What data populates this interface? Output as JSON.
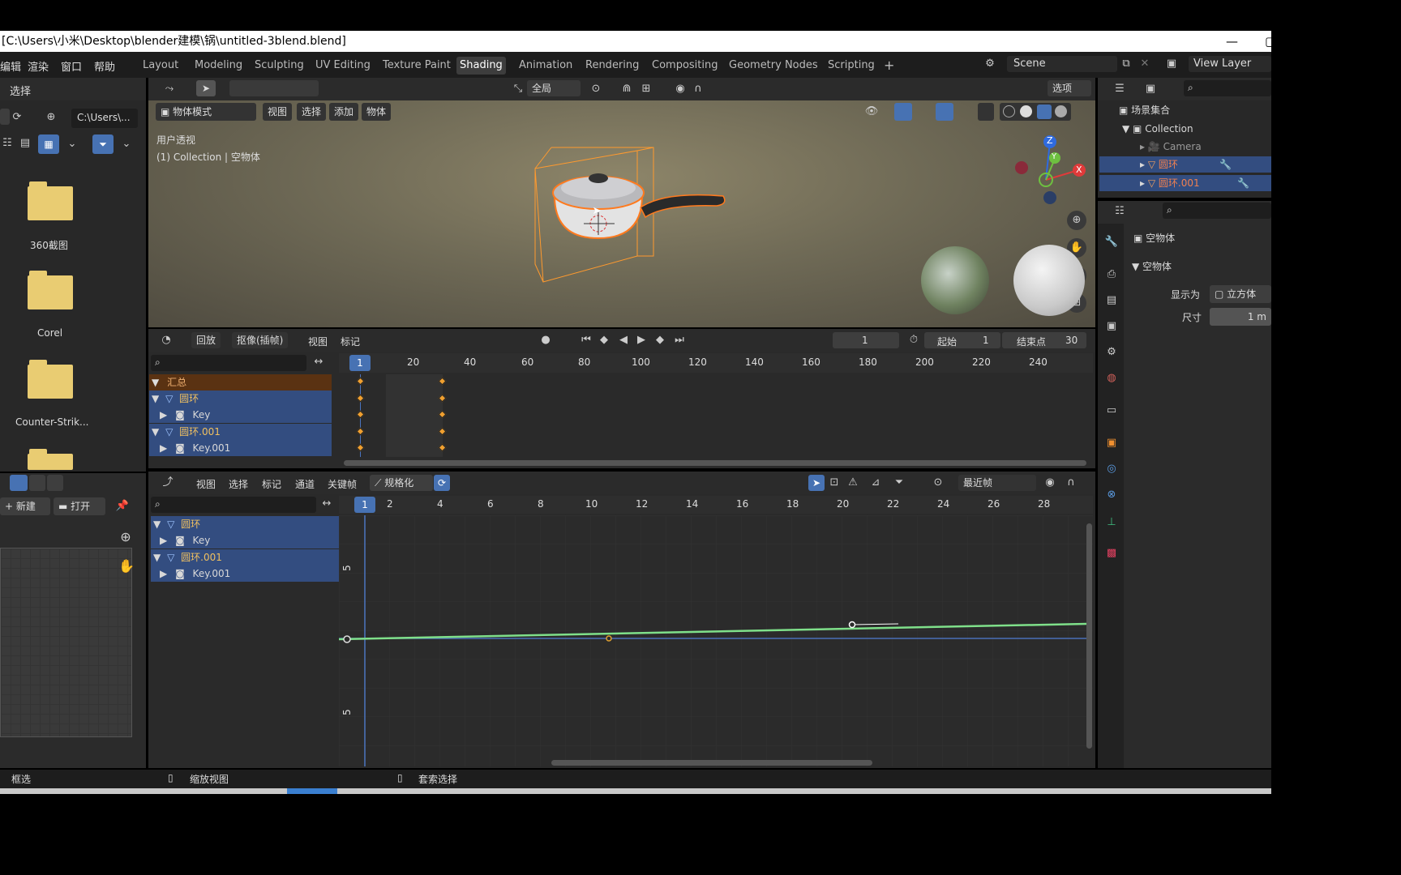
{
  "window": {
    "title": "[C:\\Users\\小米\\Desktop\\blender建模\\锅\\untitled-3blend.blend]"
  },
  "menu": {
    "items": [
      "编辑",
      "渲染",
      "窗口",
      "帮助"
    ]
  },
  "workspaces": {
    "tabs": [
      "Layout",
      "Modeling",
      "Sculpting",
      "UV Editing",
      "Texture Paint",
      "Shading",
      "Animation",
      "Rendering",
      "Compositing",
      "Geometry Nodes",
      "Scripting"
    ],
    "active": "Shading",
    "add": "+"
  },
  "scene": {
    "name": "Scene",
    "view_layer": "View Layer"
  },
  "filebrowser": {
    "header_label": "选择",
    "path": "C:\\Users\\...",
    "folders": [
      "360截图",
      "Corel",
      "Counter-Strik..."
    ]
  },
  "viewport": {
    "mode": "物体模式",
    "menus": [
      "视图",
      "选择",
      "添加",
      "物体"
    ],
    "transform_orientation": "全局",
    "options": "选项",
    "overlay_title": "用户透视",
    "overlay_sub": "(1) Collection | 空物体",
    "gizmo": {
      "z": "Z",
      "y": "Y",
      "x": "X"
    }
  },
  "timeline": {
    "menus": [
      "回放",
      "抠像(插帧)",
      "视图",
      "标记"
    ],
    "current_frame": "1",
    "start_label": "起始",
    "start": "1",
    "end_label": "结束点",
    "end": "30",
    "ruler": [
      "1",
      "20",
      "40",
      "60",
      "80",
      "100",
      "120",
      "140",
      "160",
      "180",
      "200",
      "220",
      "240"
    ],
    "channels": [
      {
        "label": "汇总",
        "kind": "summary"
      },
      {
        "label": "圆环",
        "kind": "object"
      },
      {
        "label": "Key",
        "kind": "key"
      },
      {
        "label": "圆环.001",
        "kind": "object"
      },
      {
        "label": "Key.001",
        "kind": "key"
      }
    ]
  },
  "graph": {
    "menus": [
      "视图",
      "选择",
      "标记",
      "通道",
      "关键帧"
    ],
    "normalize": "规格化",
    "snap": "最近帧",
    "ruler": [
      "1",
      "2",
      "4",
      "6",
      "8",
      "10",
      "12",
      "14",
      "16",
      "18",
      "20",
      "22",
      "24",
      "26",
      "28"
    ],
    "y_ticks": [
      "5",
      "5"
    ],
    "channels": [
      "圆环",
      "Key",
      "圆环.001",
      "Key.001"
    ],
    "curve_color": "#7fe08a"
  },
  "imageeditor": {
    "new": "新建",
    "open": "打开"
  },
  "outliner": {
    "root": "场景集合",
    "collection": "Collection",
    "items": [
      "Camera",
      "圆环",
      "圆环.001"
    ]
  },
  "properties": {
    "object_name": "空物体",
    "section": "空物体",
    "display_as_label": "显示为",
    "display_as": "立方体",
    "size_label": "尺寸",
    "size": "1 m"
  },
  "statusbar": {
    "items": [
      "框选",
      "缩放视图",
      "套索选择"
    ]
  },
  "colors": {
    "accent": "#4772b3",
    "keyframe": "#f0a030",
    "selection_outline": "#ff8a1e"
  }
}
